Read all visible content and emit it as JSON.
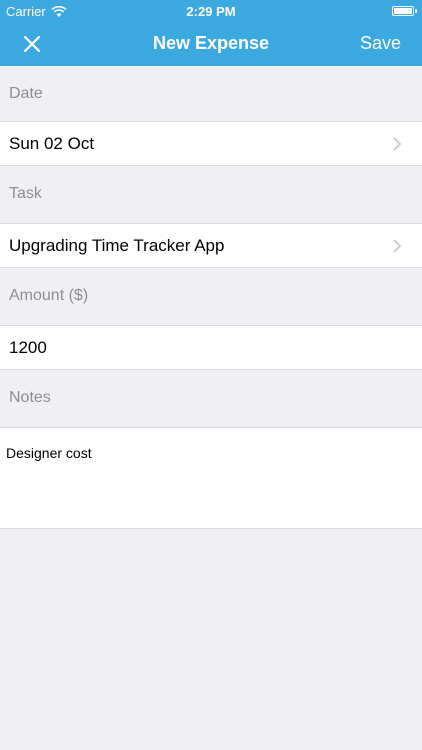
{
  "status_bar": {
    "carrier": "Carrier",
    "time": "2:29 PM",
    "wifi_icon": "wifi-icon",
    "battery_icon": "battery-icon"
  },
  "nav": {
    "title": "New Expense",
    "close_icon": "close-icon",
    "save_label": "Save"
  },
  "form": {
    "date": {
      "header": "Date",
      "value": "Sun 02 Oct"
    },
    "task": {
      "header": "Task",
      "value": "Upgrading Time Tracker App"
    },
    "amount": {
      "header": "Amount ($)",
      "value": "1200"
    },
    "notes": {
      "header": "Notes",
      "value": "Designer cost"
    }
  },
  "colors": {
    "accent": "#3ba9e0",
    "background": "#efeff4",
    "header_text": "#8e8e93"
  }
}
